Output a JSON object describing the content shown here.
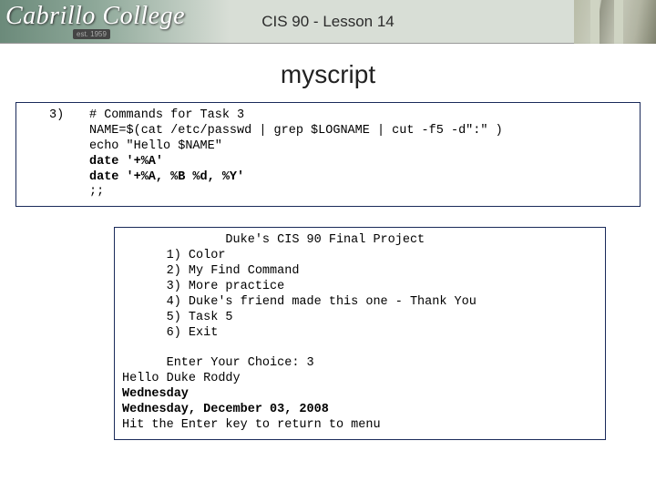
{
  "header": {
    "logo_text": "Cabrillo College",
    "est_text": "est. 1959",
    "course_title": "CIS 90 - Lesson 14"
  },
  "main_title": "myscript",
  "box1": {
    "case_label": "3)",
    "l1": "# Commands for Task 3",
    "l2": "NAME=$(cat /etc/passwd | grep $LOGNAME | cut -f5 -d\":\" )",
    "l3": "echo \"Hello $NAME\"",
    "l4": "date '+%A'",
    "l5": "date '+%A, %B %d, %Y'",
    "l6": ";;"
  },
  "box2": {
    "menu_title": "              Duke's CIS 90 Final Project",
    "m1": "      1) Color",
    "m2": "      2) My Find Command",
    "m3": "      3) More practice",
    "m4": "      4) Duke's friend made this one - Thank You",
    "m5": "      5) Task 5",
    "m6": "      6) Exit",
    "prompt": "      Enter Your Choice: 3",
    "out1": "Hello Duke Roddy",
    "out2": "Wednesday",
    "out3": "Wednesday, December 03, 2008",
    "out4": "Hit the Enter key to return to menu"
  }
}
